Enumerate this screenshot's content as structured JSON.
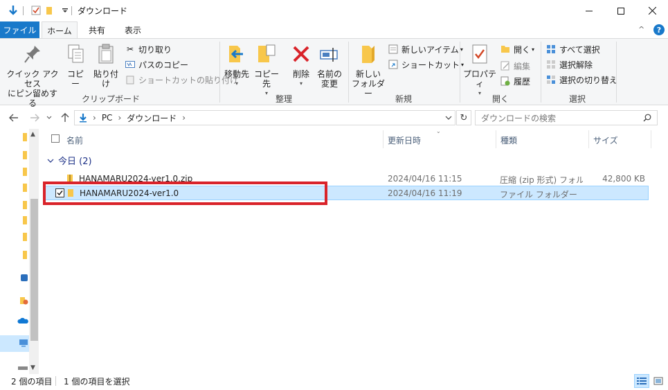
{
  "window": {
    "title": "ダウンロード",
    "controls": {
      "minimize": "—",
      "maximize": "☐",
      "close": "✕"
    }
  },
  "ribbon_tabs": [
    {
      "label": "ファイル",
      "active": false
    },
    {
      "label": "ホーム",
      "active": true
    },
    {
      "label": "共有",
      "active": false
    },
    {
      "label": "表示",
      "active": false
    }
  ],
  "ribbon": {
    "clipboard": {
      "label": "クリップボード",
      "pin": "クイック アクセス\nにピン留めする",
      "copy": "コピー",
      "paste": "貼り付け",
      "cut": "切り取り",
      "copy_path": "パスのコピー",
      "paste_shortcut": "ショートカットの貼り付け"
    },
    "organize": {
      "label": "整理",
      "move_to": "移動先",
      "copy_to": "コピー先",
      "delete": "削除",
      "rename": "名前の\n変更"
    },
    "new": {
      "label": "新規",
      "new_folder": "新しい\nフォルダー",
      "new_item": "新しいアイテム",
      "easy_access": "ショートカット"
    },
    "open": {
      "label": "開く",
      "properties": "プロパティ",
      "open": "開く",
      "edit": "編集",
      "history": "履歴"
    },
    "select": {
      "label": "選択",
      "select_all": "すべて選択",
      "select_none": "選択解除",
      "invert": "選択の切り替え"
    }
  },
  "address": {
    "crumbs": [
      "PC",
      "ダウンロード"
    ],
    "search_placeholder": "ダウンロードの検索"
  },
  "columns": {
    "name": "名前",
    "date": "更新日時",
    "type": "種類",
    "size": "サイズ"
  },
  "group": {
    "label": "今日 (2)"
  },
  "files": [
    {
      "name": "HANAMARU2024-ver1.0.zip",
      "date": "2024/04/16 11:15",
      "type": "圧縮 (zip 形式) フォル...",
      "size": "42,800 KB",
      "selected": false
    },
    {
      "name": "HANAMARU2024-ver1.0",
      "date": "2024/04/16 11:19",
      "type": "ファイル フォルダー",
      "size": "",
      "selected": true
    }
  ],
  "status": {
    "count": "2 個の項目",
    "selected": "1 個の項目を選択"
  },
  "colors": {
    "accent": "#1979ca",
    "selection": "#cce8ff",
    "highlight": "#d9232a",
    "folder": "#f8c74b"
  }
}
